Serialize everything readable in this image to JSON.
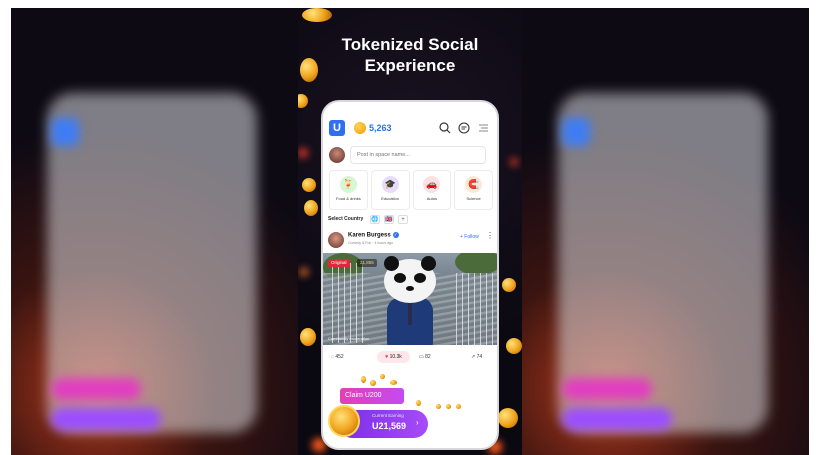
{
  "headline": {
    "line1": "Tokenized Social",
    "line2": "Experience"
  },
  "app": {
    "logo_letter": "U",
    "token_balance": "5,263",
    "compose_placeholder": "Post in space name...",
    "categories": [
      {
        "label": "Food & drinks",
        "icon": "food-icon",
        "color": "#d8f5d4"
      },
      {
        "label": "Education",
        "icon": "education-icon",
        "color": "#e6dcfb"
      },
      {
        "label": "Autos",
        "icon": "car-icon",
        "color": "#fde0e0"
      },
      {
        "label": "Science",
        "icon": "science-icon",
        "color": "#fde8d4"
      }
    ],
    "country_label": "Select Country",
    "country_chips": [
      "🌐",
      "🇬🇧",
      "+"
    ],
    "post": {
      "author": "Karen Burgess",
      "meta": "Comedy & Fun · 4 hours ago",
      "follow_label": "+ Follow",
      "original_badge": "Original",
      "views_badge": "21,855",
      "moderation_label": "Community moderation",
      "comments": "452",
      "likes": "10.3k",
      "replies": "82",
      "shares": "74"
    },
    "claim_label": "Claim U200",
    "earning": {
      "label": "Current Earning",
      "value": "U21,569"
    }
  },
  "colors": {
    "brand_blue": "#2f6ff0",
    "claim_pink": "#e33fb4",
    "earning_purple": "#7a2ee6"
  }
}
